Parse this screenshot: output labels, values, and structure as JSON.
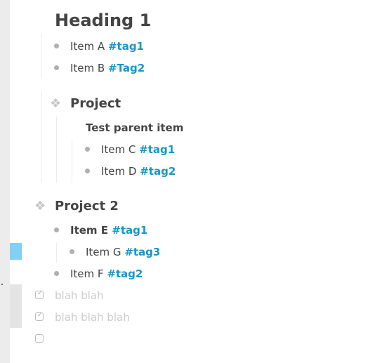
{
  "heading": "Heading 1",
  "list1": [
    {
      "text": "Item A ",
      "tag": "#tag1"
    },
    {
      "text": "Item B ",
      "tag": "#Tag2"
    }
  ],
  "project1": {
    "title": "Project",
    "parent": "Test parent item",
    "children": [
      {
        "text": "Item C ",
        "tag": "#tag1"
      },
      {
        "text": "Item D ",
        "tag": "#tag2"
      }
    ]
  },
  "project2": {
    "title": "Project 2",
    "itemE": {
      "text": "Item E ",
      "tag": "#tag1"
    },
    "itemG": {
      "text": "Item G ",
      "tag": "#tag3"
    },
    "itemF": {
      "text": "Item F ",
      "tag": "#tag2"
    }
  },
  "tasks": [
    {
      "text": "blah blah",
      "done": true
    },
    {
      "text": "blah blah blah",
      "done": true
    },
    {
      "text": "",
      "done": false
    }
  ],
  "colors": {
    "tag": "#1a96c6",
    "highlight": "#7fd2f4"
  },
  "icons": {
    "project": "diamond-cluster-icon",
    "bullet": "bullet-dot-icon",
    "task": "checkbox-icon"
  }
}
